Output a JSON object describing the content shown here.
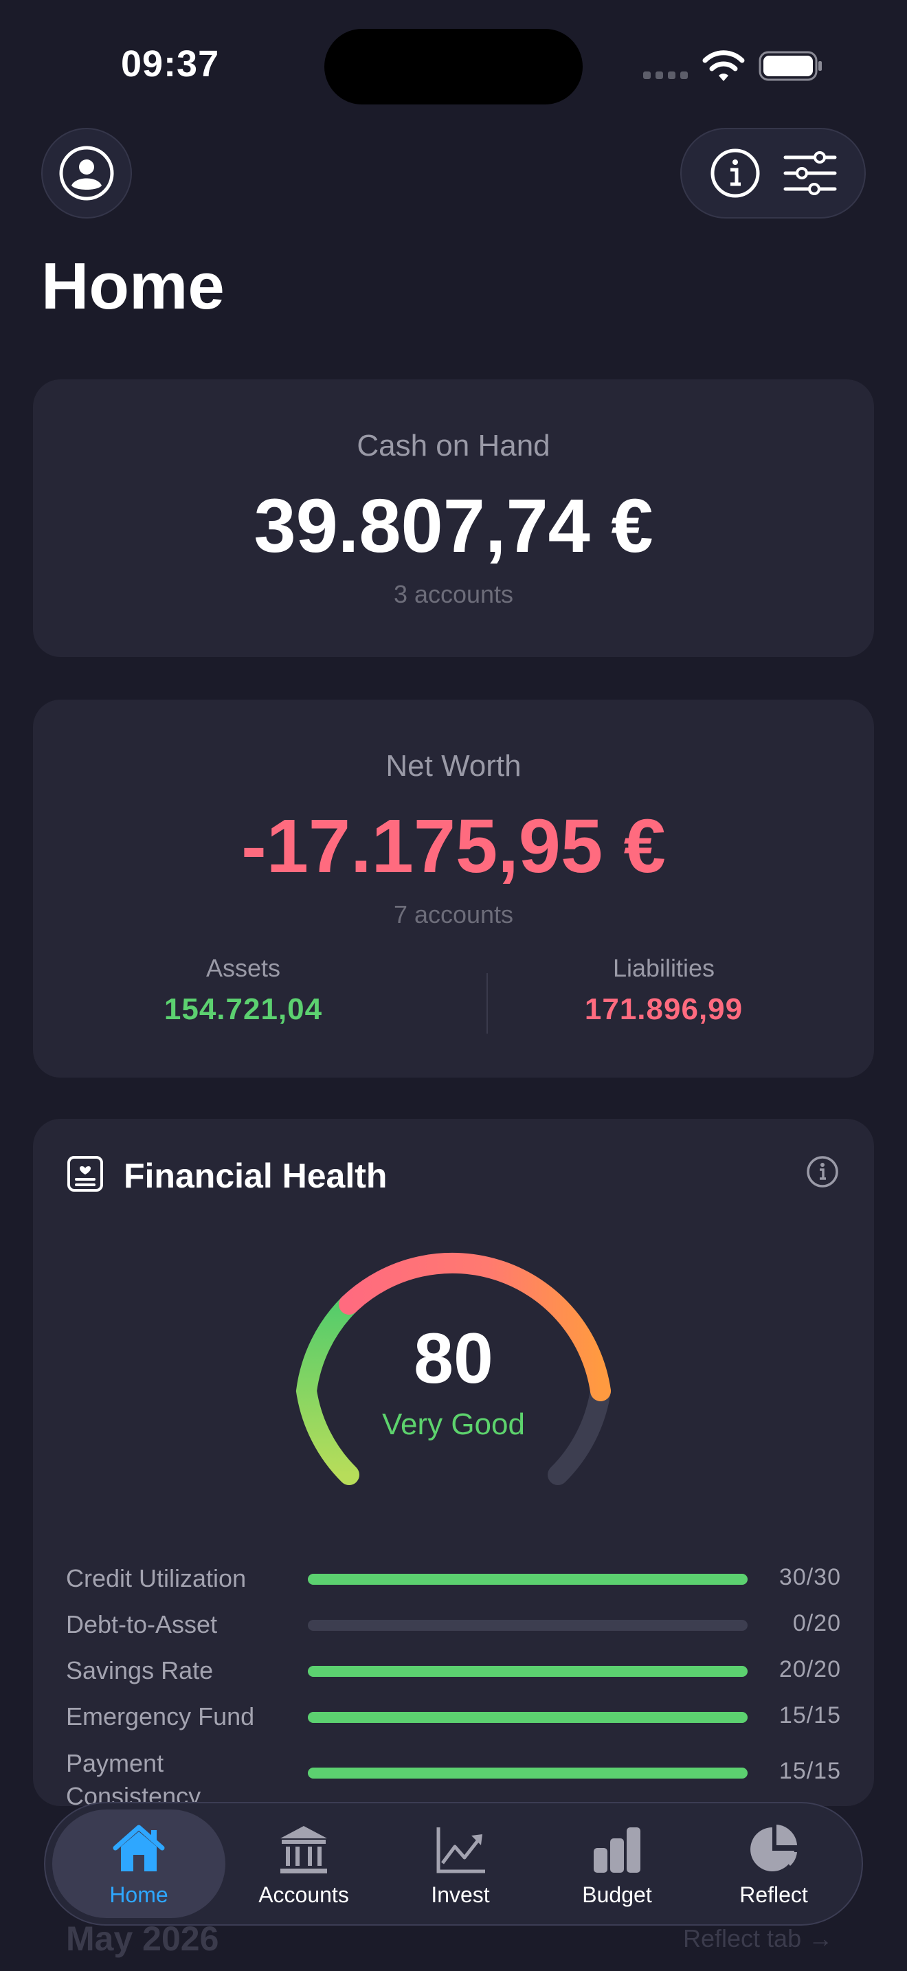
{
  "status_bar": {
    "time": "09:37"
  },
  "header": {
    "title": "Home"
  },
  "cash_card": {
    "label": "Cash on Hand",
    "value": "39.807,74 €",
    "sub": "3 accounts"
  },
  "net_worth_card": {
    "label": "Net Worth",
    "value": "-17.175,95 €",
    "sub": "7 accounts",
    "assets_label": "Assets",
    "assets_value": "154.721,04",
    "liabilities_label": "Liabilities",
    "liabilities_value": "171.896,99"
  },
  "financial_health": {
    "title": "Financial Health",
    "score": "80",
    "rating": "Very Good",
    "metrics": [
      {
        "name": "Credit Utilization",
        "score": "30/30",
        "fraction": 1.0
      },
      {
        "name": "Debt-to-Asset",
        "score": "0/20",
        "fraction": 0.0
      },
      {
        "name": "Savings Rate",
        "score": "20/20",
        "fraction": 1.0
      },
      {
        "name": "Emergency Fund",
        "score": "15/15",
        "fraction": 1.0
      },
      {
        "name": "Payment Consistency",
        "score": "15/15",
        "fraction": 1.0
      }
    ]
  },
  "below": {
    "month": "May 2026",
    "link": "Reflect tab →"
  },
  "tabbar": {
    "items": [
      {
        "label": "Home",
        "icon": "house-icon",
        "active": true
      },
      {
        "label": "Accounts",
        "icon": "bank-icon"
      },
      {
        "label": "Invest",
        "icon": "chart-line-icon"
      },
      {
        "label": "Budget",
        "icon": "bar-chart-icon"
      },
      {
        "label": "Reflect",
        "icon": "pie-chart-icon"
      }
    ]
  },
  "colors": {
    "background": "#1b1b29",
    "card": "#262636",
    "positive": "#5cd170",
    "negative": "#ff6b7f",
    "accent": "#2ea7ff"
  }
}
